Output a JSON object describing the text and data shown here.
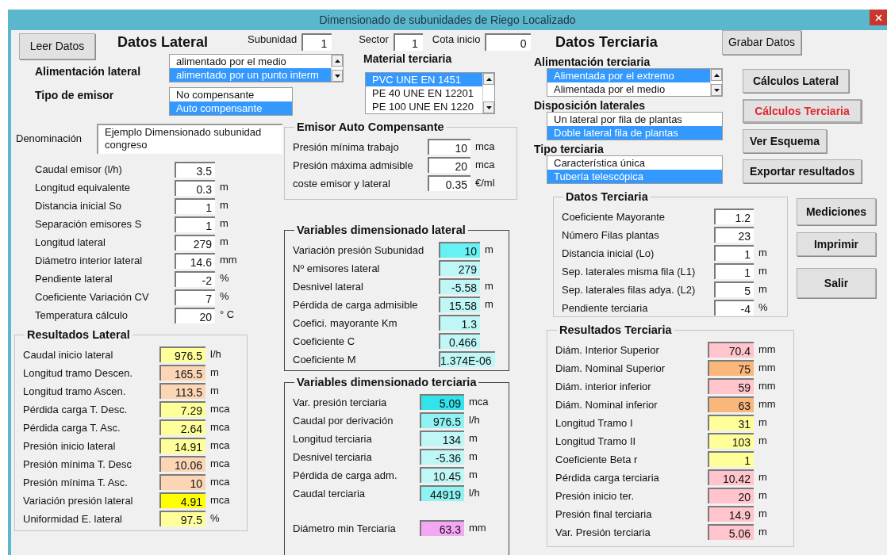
{
  "window": {
    "title": "Dimensionado de subunidades de Riego Localizado"
  },
  "read_button": "Leer Datos",
  "lateral_heading": "Datos Lateral",
  "header_fields": [
    {
      "label": "Subunidad",
      "value": "1"
    },
    {
      "label": "Sector",
      "value": "1"
    },
    {
      "label": "Cota inicio",
      "value": "0"
    }
  ],
  "alimentacion_lateral": {
    "label": "Alimentación lateral",
    "scroll": true,
    "options": [
      {
        "text": "alimentado por el medio",
        "selected": false
      },
      {
        "text": "alimentado por un punto interm",
        "selected": true
      }
    ]
  },
  "tipo_emisor": {
    "label": "Tipo de emisor",
    "scroll": false,
    "options": [
      {
        "text": "No compensante",
        "selected": false
      },
      {
        "text": "Auto compensante",
        "selected": true
      }
    ]
  },
  "denominacion": {
    "label": "Denominación",
    "value": "Ejemplo Dimensionado subunidad congreso"
  },
  "lateral_inputs": [
    {
      "label": "Caudal emisor (l/h)",
      "value": "3.5"
    },
    {
      "label": "Longitud equivalente",
      "value": "0.3",
      "unit": "m"
    },
    {
      "label": "Distancia inicial So",
      "value": "1",
      "unit": "m"
    },
    {
      "label": "Separación emisores S",
      "value": "1",
      "unit": "m"
    },
    {
      "label": "Longitud lateral",
      "value": "279",
      "unit": "m"
    },
    {
      "label": "Diámetro interior lateral",
      "value": "14.6",
      "unit": "mm"
    },
    {
      "label": "Pendiente lateral",
      "value": "-2",
      "unit": "%"
    },
    {
      "label": "Coeficiente Variación CV",
      "value": "7",
      "unit": "%"
    },
    {
      "label": "Temperatura cálculo",
      "value": "20",
      "unit": "° C"
    }
  ],
  "resultados_lateral": {
    "title": "Resultados Lateral",
    "rows": [
      {
        "label": "Caudal inicio lateral",
        "value": "976.5",
        "unit": "l/h",
        "color": "#ffff99"
      },
      {
        "label": "Longitud tramo Descen.",
        "value": "165.5",
        "unit": "m",
        "color": "#fcd5b4"
      },
      {
        "label": "Longitud tramo Ascen.",
        "value": "113.5",
        "unit": "m",
        "color": "#fcd5b4"
      },
      {
        "label": "Pérdida carga T. Desc.",
        "value": "7.29",
        "unit": "mca",
        "color": "#ffff99"
      },
      {
        "label": "Pérdida carga T. Asc.",
        "value": "2.64",
        "unit": "mca",
        "color": "#ffff99"
      },
      {
        "label": "Presión inicio lateral",
        "value": "14.91",
        "unit": "mca",
        "color": "#ffff99"
      },
      {
        "label": "Presión mínima T. Desc",
        "value": "10.06",
        "unit": "mca",
        "color": "#fcd5b4"
      },
      {
        "label": "Presión mínima T. Asc.",
        "value": "10",
        "unit": "mca",
        "color": "#fcd5b4"
      },
      {
        "label": "Variación presión lateral",
        "value": "4.91",
        "unit": "mca",
        "color": "#ffff00"
      },
      {
        "label": "Uniformidad E. lateral",
        "value": "97.5",
        "unit": "%",
        "color": "#ffff99"
      }
    ]
  },
  "material_terciaria": {
    "label": "Material terciaria",
    "scroll": true,
    "options": [
      {
        "text": "PVC UNE EN 1451",
        "selected": true
      },
      {
        "text": "PE 40 UNE EN 12201",
        "selected": false
      },
      {
        "text": "PE 100 UNE EN 1220",
        "selected": false
      }
    ]
  },
  "emisor": {
    "title": "Emisor Auto Compensante",
    "rows": [
      {
        "label": "Presión mínima trabajo",
        "value": "10",
        "unit": "mca"
      },
      {
        "label": "Presión máxima admisible",
        "value": "20",
        "unit": "mca"
      },
      {
        "label": "coste emisor y lateral",
        "value": "0.35",
        "unit": "€/ml"
      }
    ]
  },
  "variables_lateral": {
    "title": "Variables dimensionado lateral",
    "rows": [
      {
        "label": "Variación presión Subunidad",
        "value": "10",
        "unit": "m",
        "color": "#66f2f2"
      },
      {
        "label": "Nº emisores lateral",
        "value": "279",
        "color": "#bff7f7"
      },
      {
        "label": "Desnivel lateral",
        "value": "-5.58",
        "unit": "m",
        "color": "#bff7f7"
      },
      {
        "label": "Pérdida de carga admisible",
        "value": "15.58",
        "unit": "m",
        "color": "#bff7f7"
      },
      {
        "label": "Coefici. mayorante Km",
        "value": "1.3",
        "color": "#bff7f7"
      },
      {
        "label": "Coeficiente C",
        "value": "0.466",
        "color": "#bff7f7"
      },
      {
        "label": "Coeficiente M",
        "value": "1.374E-06",
        "color": "#bff7f7"
      }
    ]
  },
  "variables_terciaria": {
    "title": "Variables dimensionado terciaria",
    "rows": [
      {
        "label": "Var. presión terciaria",
        "value": "5.09",
        "unit": "mca",
        "color": "#33e3ea"
      },
      {
        "label": "Caudal por derivación",
        "value": "976.5",
        "unit": "l/h",
        "color": "#8ff3f3"
      },
      {
        "label": "Longitud terciaria",
        "value": "134",
        "unit": "m",
        "color": "#bff7f7"
      },
      {
        "label": "Desnivel terciaria",
        "value": "-5.36",
        "unit": "m",
        "color": "#bff7f7"
      },
      {
        "label": "Pérdida de carga adm.",
        "value": "10.45",
        "unit": "m",
        "color": "#bff7f7"
      },
      {
        "label": "Caudal terciaria",
        "value": "44919",
        "unit": "l/h",
        "color": "#8ff3f3"
      }
    ],
    "result": {
      "label": "Diámetro min Terciaria",
      "value": "63.3",
      "unit": "mm",
      "color": "#f4a8f4"
    }
  },
  "terciaria_heading": "Datos Terciaria",
  "save_button": "Grabar Datos",
  "terciaria_lists": [
    {
      "label": "Alimentación terciaria",
      "scroll": true,
      "options": [
        {
          "text": "Alimentada por el extremo",
          "selected": true
        },
        {
          "text": "Alimentada por el medio",
          "selected": false
        }
      ]
    },
    {
      "label": "Disposición laterales",
      "scroll": false,
      "options": [
        {
          "text": "Un lateral por fila de plantas",
          "selected": false
        },
        {
          "text": "Doble lateral fila de plantas",
          "selected": true
        }
      ]
    },
    {
      "label": "Tipo terciaria",
      "scroll": false,
      "options": [
        {
          "text": "Característica única",
          "selected": false
        },
        {
          "text": "Tubería telescópica",
          "selected": true
        }
      ]
    }
  ],
  "action_buttons": [
    {
      "label": "Cálculos Lateral",
      "focused": false
    },
    {
      "label": "Cálculos Terciaria",
      "focused": true
    },
    {
      "label": "Ver Esquema",
      "focused": false
    },
    {
      "label": "Exportar resultados",
      "focused": false
    }
  ],
  "side_buttons": [
    {
      "label": "Mediciones"
    },
    {
      "label": "Imprimir"
    },
    {
      "label": "Salir"
    }
  ],
  "datos_terciaria": {
    "title": "Datos Terciaria",
    "rows": [
      {
        "label": "Coeficiente Mayorante",
        "value": "1.2"
      },
      {
        "label": "Número Filas plantas",
        "value": "23"
      },
      {
        "label": "Distancia inicial (Lo)",
        "value": "1",
        "unit": "m"
      },
      {
        "label": "Sep. laterales misma fila (L1)",
        "value": "1",
        "unit": "m"
      },
      {
        "label": "Sep. laterales filas adya. (L2)",
        "value": "5",
        "unit": "m"
      },
      {
        "label": "Pendiente terciaria",
        "value": "-4",
        "unit": "%"
      }
    ]
  },
  "resultados_terciaria": {
    "title": "Resultados Terciaria",
    "rows": [
      {
        "label": "Diám. Interior Superior",
        "value": "70.4",
        "unit": "mm",
        "color": "#ffc4cc"
      },
      {
        "label": "Diam. Nominal Superior",
        "value": "75",
        "unit": "mm",
        "color": "#f9b87a"
      },
      {
        "label": "Diám. interior inferior",
        "value": "59",
        "unit": "mm",
        "color": "#ffc4cc"
      },
      {
        "label": "Diám. Nominal inferior",
        "value": "63",
        "unit": "mm",
        "color": "#f9b87a"
      },
      {
        "label": "Longitud Tramo I",
        "value": "31",
        "unit": "m",
        "color": "#ffff99"
      },
      {
        "label": "Longitud Tramo II",
        "value": "103",
        "unit": "m",
        "color": "#ffff99"
      },
      {
        "label": "Coeficiente Beta r",
        "value": "1",
        "color": "#ffff99"
      },
      {
        "label": "Pérdida carga terciaria",
        "value": "10.42",
        "unit": "m",
        "color": "#ffc4cc"
      },
      {
        "label": "Presión inicio ter.",
        "value": "20",
        "unit": "m",
        "color": "#ffc4cc"
      },
      {
        "label": "Presión final terciaria",
        "value": "14.9",
        "unit": "m",
        "color": "#ffc4cc"
      },
      {
        "label": "Var. Presión terciaria",
        "value": "5.06",
        "unit": "m",
        "color": "#ffc4cc"
      }
    ]
  }
}
